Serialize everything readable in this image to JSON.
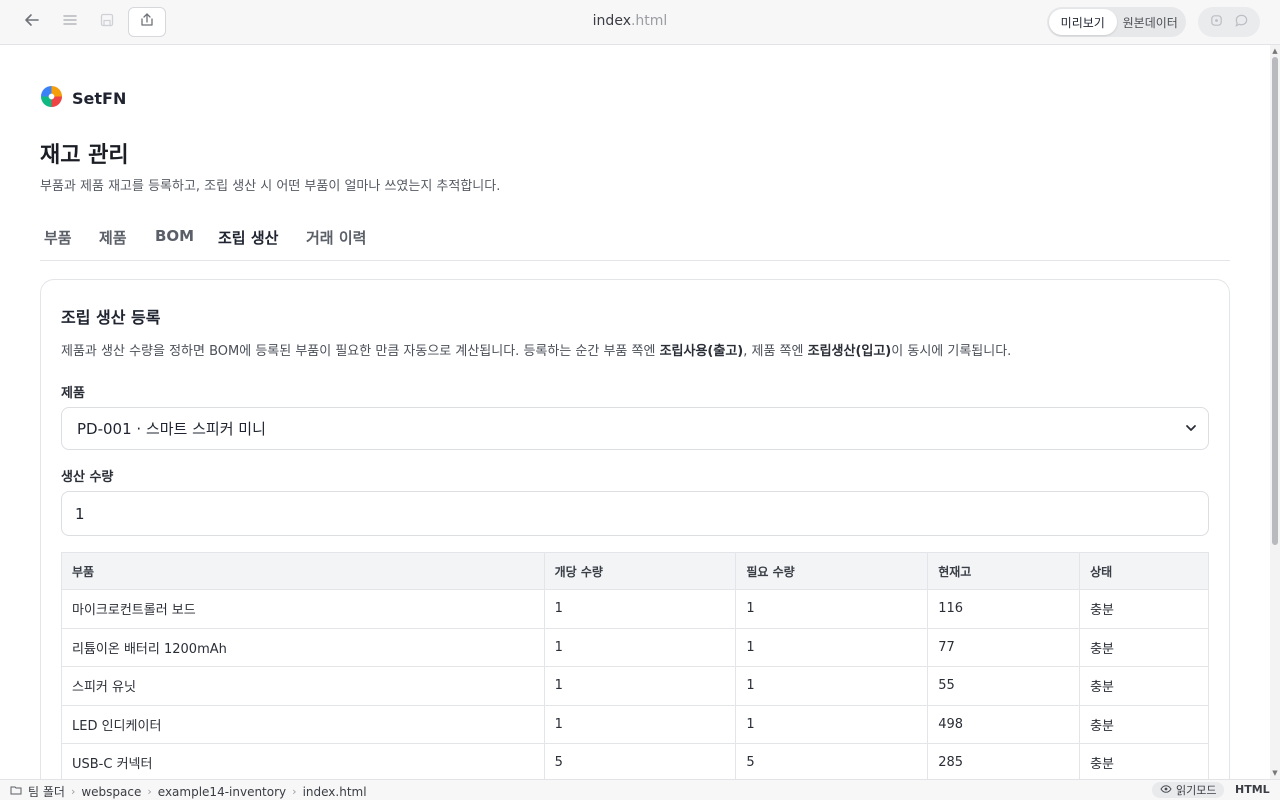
{
  "toolbar": {
    "file_name": "index",
    "file_ext": ".html",
    "view_toggle": {
      "preview_label": "미리보기",
      "source_label": "원본데이터",
      "active": "preview"
    }
  },
  "brand": {
    "name": "SetFN"
  },
  "page": {
    "title": "재고 관리",
    "subtitle": "부품과 제품 재고를 등록하고, 조립 생산 시 어떤 부품이 얼마나 쓰였는지 추적합니다."
  },
  "tabs": [
    {
      "label": "부품",
      "active": false
    },
    {
      "label": "제품",
      "active": false
    },
    {
      "label": "BOM",
      "active": false
    },
    {
      "label": "조립 생산",
      "active": true
    },
    {
      "label": "거래 이력",
      "active": false
    }
  ],
  "assembly": {
    "title": "조립 생산 등록",
    "desc_part1": "제품과 생산 수량을 정하면 BOM에 등록된 부품이 필요한 만큼 자동으로 계산됩니다. 등록하는 순간 부품 쪽엔 ",
    "desc_bold1": "조립사용(출고)",
    "desc_part2": ", 제품 쪽엔 ",
    "desc_bold2": "조립생산(입고)",
    "desc_part3": "이 동시에 기록됩니다.",
    "product_label": "제품",
    "product_value": "PD-001 · 스마트 스피커 미니",
    "qty_label": "생산 수량",
    "qty_value": "1",
    "table": {
      "headers": [
        "부품",
        "개당 수량",
        "필요 수량",
        "현재고",
        "상태"
      ],
      "rows": [
        [
          "마이크로컨트롤러 보드",
          "1",
          "1",
          "116",
          "충분"
        ],
        [
          "리튬이온 배터리 1200mAh",
          "1",
          "1",
          "77",
          "충분"
        ],
        [
          "스피커 유닛",
          "1",
          "1",
          "55",
          "충분"
        ],
        [
          "LED 인디케이터",
          "1",
          "1",
          "498",
          "충분"
        ],
        [
          "USB-C 커넥터",
          "5",
          "5",
          "285",
          "충분"
        ]
      ]
    }
  },
  "statusbar": {
    "breadcrumbs": [
      "팀 폴더",
      "webspace",
      "example14-inventory",
      "index.html"
    ],
    "reader_label": "읽기모드",
    "language": "HTML"
  },
  "colors": {
    "brand_blue": "#3b82f6",
    "brand_orange": "#f59e0b",
    "brand_green": "#10b981",
    "brand_red": "#ef4444"
  }
}
